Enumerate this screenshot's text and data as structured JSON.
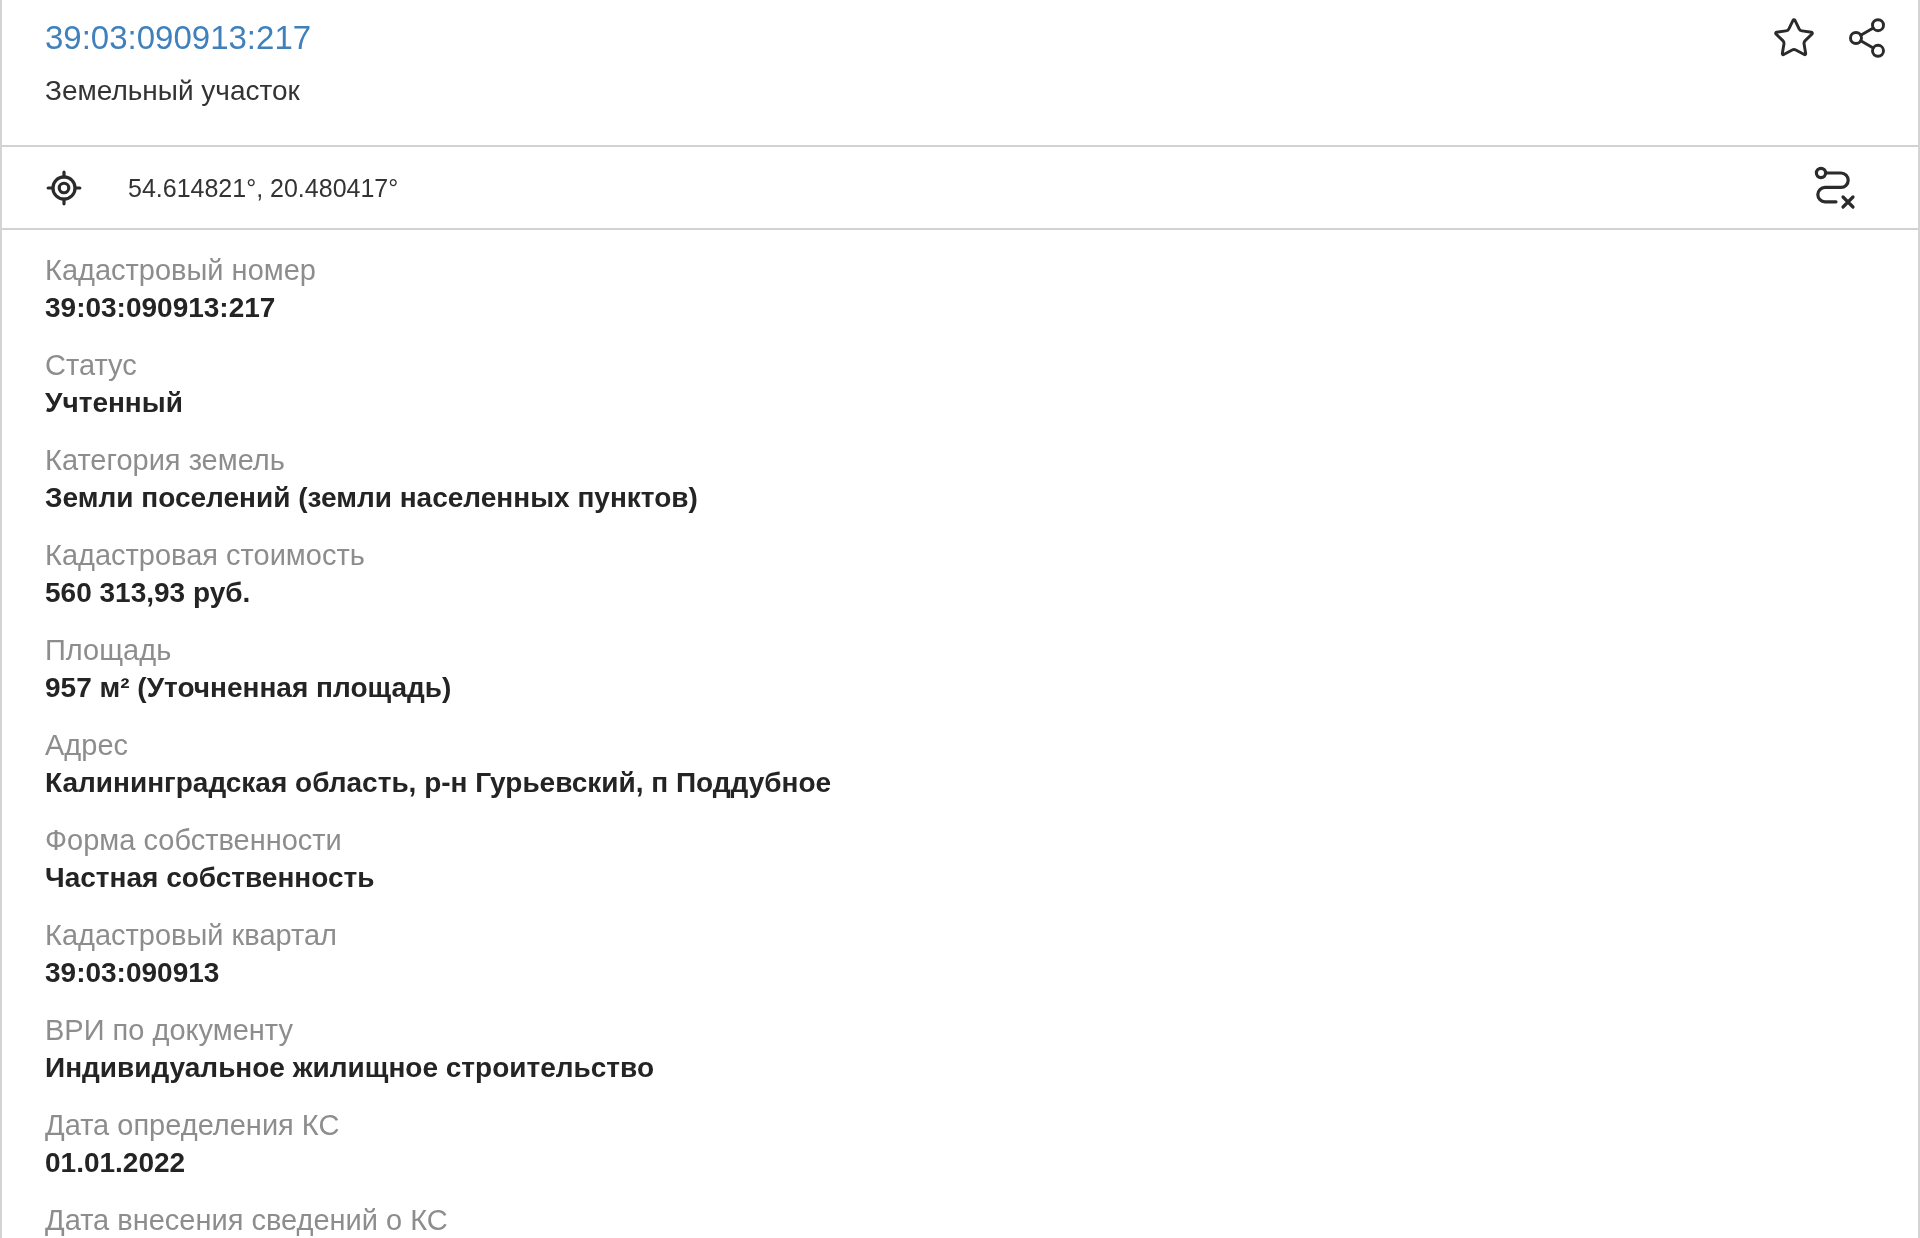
{
  "header": {
    "title": "39:03:090913:217",
    "subtitle": "Земельный участок"
  },
  "location": {
    "coordinates": "54.614821°, 20.480417°"
  },
  "fields": [
    {
      "label": "Кадастровый номер",
      "value": "39:03:090913:217"
    },
    {
      "label": "Статус",
      "value": "Учтенный"
    },
    {
      "label": "Категория земель",
      "value": "Земли поселений (земли населенных пунктов)"
    },
    {
      "label": "Кадастровая стоимость",
      "value": "560 313,93 руб."
    },
    {
      "label": "Площадь",
      "value": "957 м² (Уточненная площадь)"
    },
    {
      "label": "Адрес",
      "value": "Калининградская область, р-н Гурьевский, п Поддубное"
    },
    {
      "label": "Форма собственности",
      "value": "Частная собственность"
    },
    {
      "label": "Кадастровый квартал",
      "value": "39:03:090913"
    },
    {
      "label": "ВРИ по документу",
      "value": "Индивидуальное жилищное строительство"
    },
    {
      "label": "Дата определения КС",
      "value": "01.01.2022"
    },
    {
      "label": "Дата внесения сведений о КС"
    }
  ]
}
